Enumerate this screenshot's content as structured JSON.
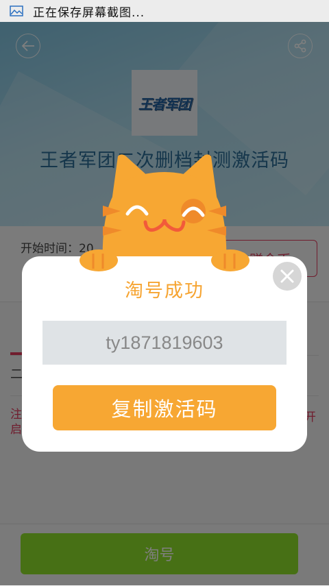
{
  "status_bar": {
    "text": "正在保存屏幕截图..."
  },
  "header": {
    "title": "王者军团二次删档封测激活码",
    "logo_text": "王者军团"
  },
  "info": {
    "start_time_label": "开始时间：20",
    "right_button_label": "赚金币"
  },
  "content": {
    "row_text": "二",
    "notice_left": "注\n启",
    "notice_right": "开"
  },
  "bottom": {
    "tao_button_label": "淘号"
  },
  "dialog": {
    "title": "淘号成功",
    "code": "ty1871819603",
    "copy_button_label": "复制激活码"
  },
  "colors": {
    "accent_orange": "#f7a733",
    "title_orange": "#f6a431",
    "hero_blue": "#7fc3e0",
    "tao_green": "#8ee02a",
    "notice_red": "#e03a5c"
  },
  "icons": [
    "image-icon",
    "back-arrow-icon",
    "share-icon",
    "close-icon",
    "cat-mascot"
  ]
}
